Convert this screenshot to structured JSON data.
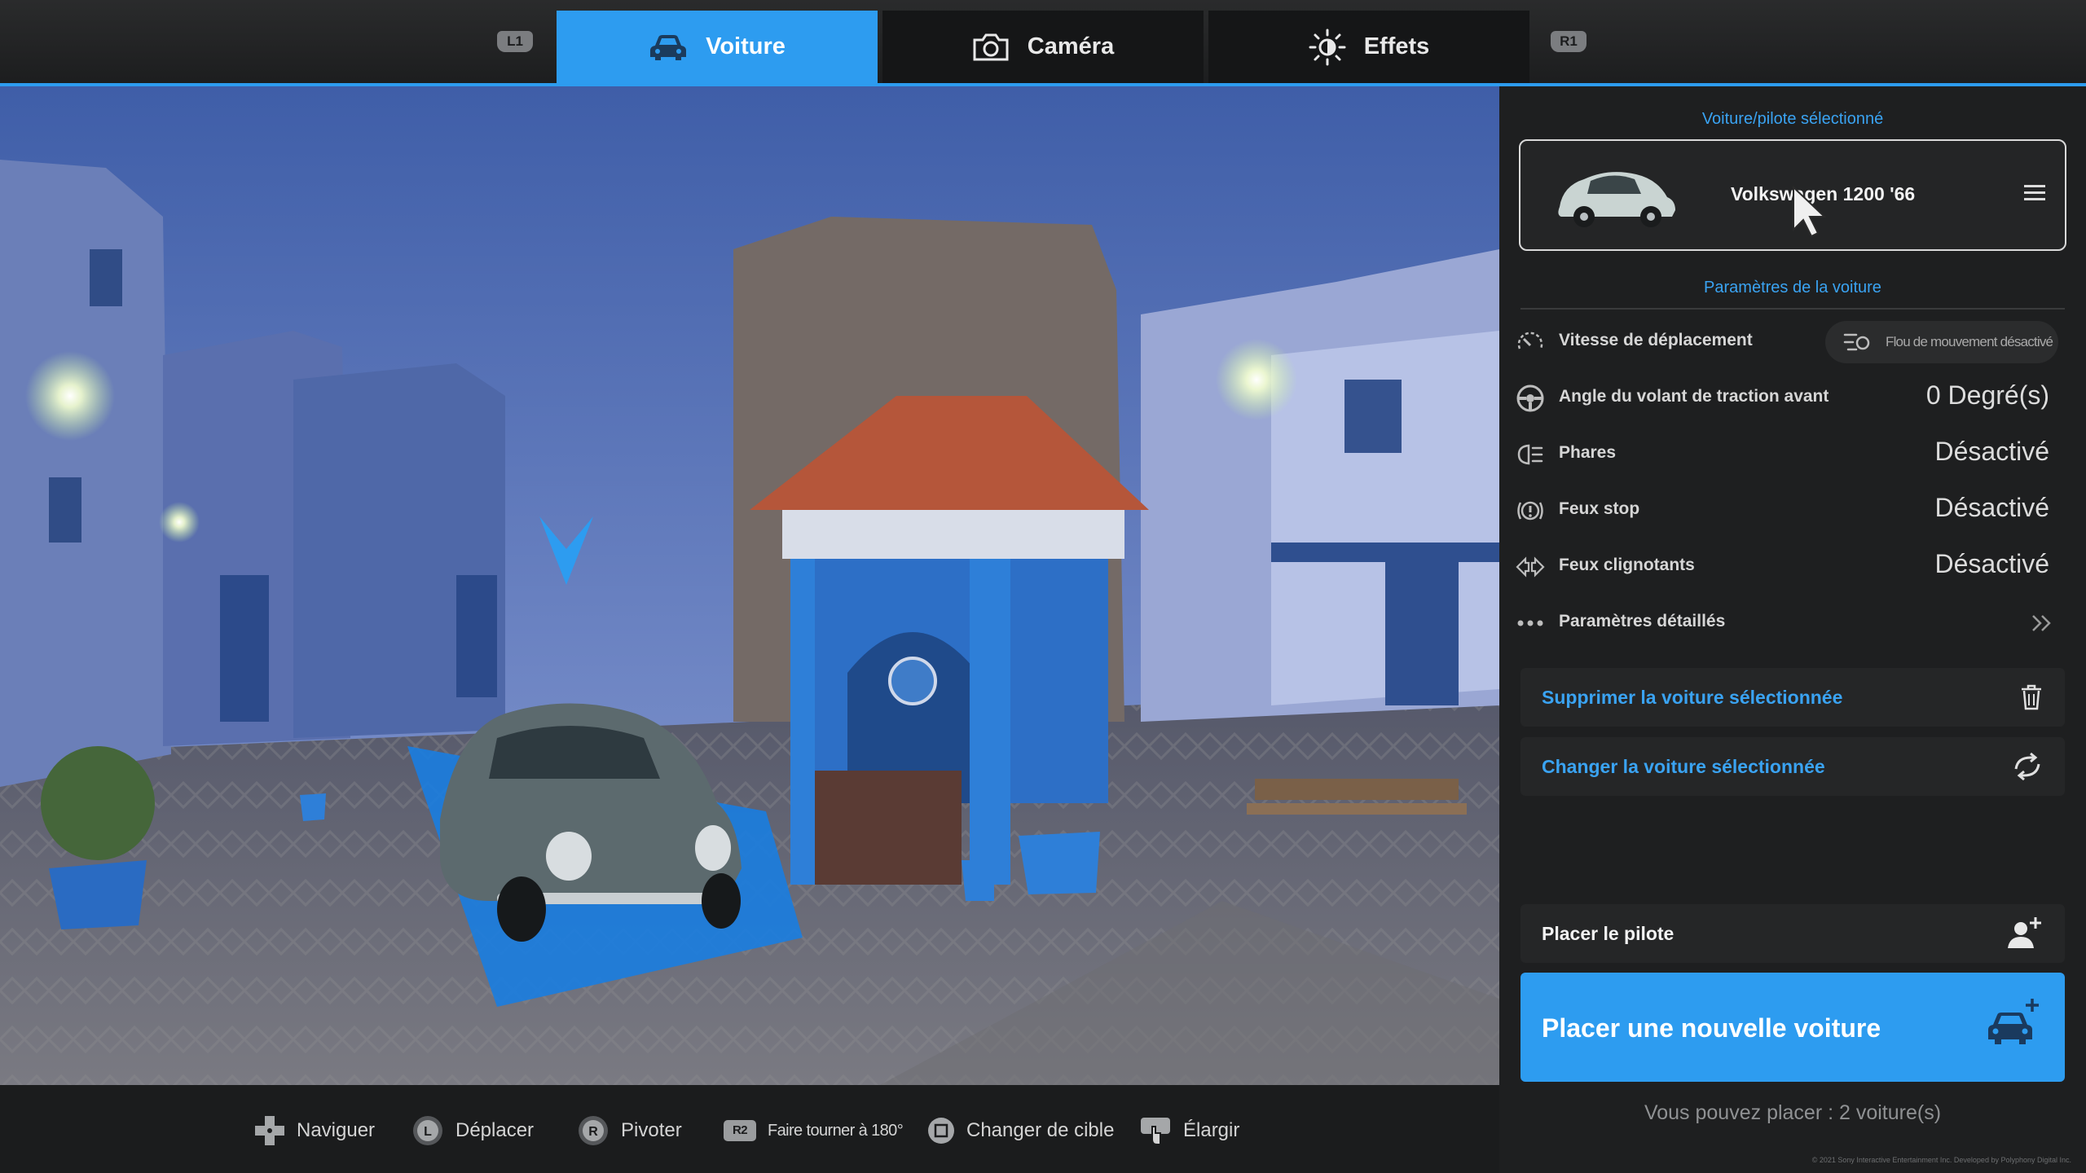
{
  "tabs": {
    "shoulder_left": "L1",
    "shoulder_right": "R1",
    "items": [
      {
        "label": "Voiture",
        "icon": "car-icon",
        "active": true
      },
      {
        "label": "Caméra",
        "icon": "camera-icon",
        "active": false
      },
      {
        "label": "Effets",
        "icon": "brightness-icon",
        "active": false
      }
    ]
  },
  "panel": {
    "selected_title": "Voiture/pilote sélectionné",
    "car_name": "Volkswagen 1200 '66",
    "settings_title": "Paramètres de la voiture",
    "settings": [
      {
        "label": "Vitesse de déplacement",
        "icon": "speedometer-icon",
        "value": "Flou de mouvement désactivé"
      },
      {
        "label": "Angle du volant de traction avant",
        "icon": "steering-wheel-icon",
        "value": "0 Degré(s)"
      },
      {
        "label": "Phares",
        "icon": "headlight-icon",
        "value": "Désactivé"
      },
      {
        "label": "Feux stop",
        "icon": "brake-light-icon",
        "value": "Désactivé"
      },
      {
        "label": "Feux clignotants",
        "icon": "turn-signal-icon",
        "value": "Désactivé"
      },
      {
        "label": "Paramètres détaillés",
        "icon": "more-dots-icon",
        "value": ""
      }
    ],
    "delete_label": "Supprimer la voiture sélectionnée",
    "change_label": "Changer la voiture sélectionnée",
    "place_driver_label": "Placer le pilote",
    "place_car_label": "Placer une nouvelle voiture",
    "remaining_text": "Vous pouvez placer : 2 voiture(s)",
    "copyright": "© 2021 Sony Interactive Entertainment Inc. Developed by Polyphony Digital Inc."
  },
  "controls": [
    {
      "label": "Naviguer",
      "icon": "dpad-icon"
    },
    {
      "label": "Déplacer",
      "icon": "left-stick-icon",
      "badge": "L"
    },
    {
      "label": "Pivoter",
      "icon": "right-stick-icon",
      "badge": "R"
    },
    {
      "label": "Faire tourner à 180°",
      "icon": "r2-button-icon",
      "badge": "R2"
    },
    {
      "label": "Changer de cible",
      "icon": "square-button-icon"
    },
    {
      "label": "Élargir",
      "icon": "touchpad-icon"
    }
  ],
  "colors": {
    "accent": "#2d9cf0",
    "panel_bg": "#1e1f20",
    "text_blue": "#3aa3f2"
  }
}
